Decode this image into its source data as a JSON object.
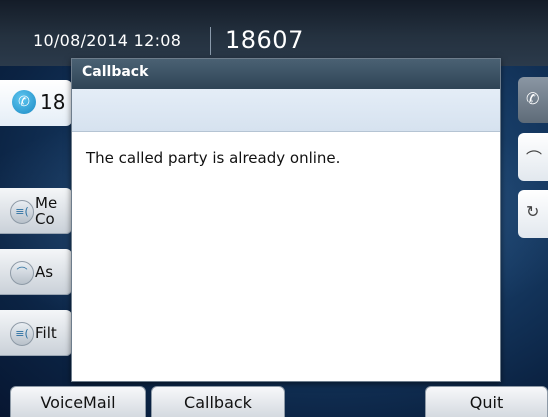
{
  "header": {
    "datetime": "10/08/2014 12:08",
    "extension": "18607"
  },
  "line": {
    "label": "18"
  },
  "side_buttons": [
    {
      "label_line1": "Me",
      "label_line2": "Co",
      "icon": "message-icon"
    },
    {
      "label": "As",
      "icon": "handset-icon"
    },
    {
      "label": "Filt",
      "icon": "filter-icon"
    }
  ],
  "dialog": {
    "title": "Callback",
    "message": "The called party is already online."
  },
  "softkeys": {
    "voicemail": "VoiceMail",
    "callback": "Callback",
    "quit": "Quit"
  },
  "icons": {
    "line": "phone-icon",
    "right_tabs": [
      "phone-icon",
      "hangup-icon",
      "redial-icon"
    ]
  },
  "colors": {
    "accent": "#2f4456",
    "background": "#163a63",
    "line_icon": "#1c8ac4"
  }
}
